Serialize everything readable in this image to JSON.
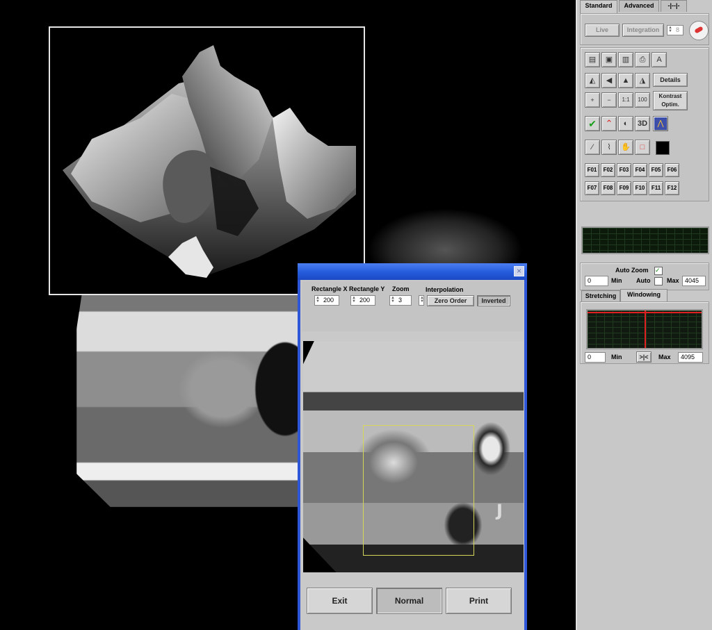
{
  "dialog": {
    "labels": {
      "rect_x": "Rectangle X",
      "rect_y": "Rectangle Y",
      "zoom": "Zoom",
      "interpolation": "Interpolation"
    },
    "values": {
      "rect_x": "200",
      "rect_y": "200",
      "zoom": "3"
    },
    "buttons": {
      "zero_order": "Zero Order",
      "inverted": "Inverted",
      "exit": "Exit",
      "normal": "Normal",
      "print": "Print"
    },
    "close_glyph": "×"
  },
  "panel": {
    "tabs": [
      "Standard",
      "Advanced",
      "-|--|-"
    ],
    "top_controls": {
      "live": "Live",
      "integration": "Integration",
      "integration_value": "8"
    },
    "tools": {
      "details": "Details",
      "kontrast": "Kontrast Optim.",
      "three_d": "3D",
      "zoom_100": "100"
    },
    "fkeys": [
      "F01",
      "F02",
      "F03",
      "F04",
      "F05",
      "F06",
      "F07",
      "F08",
      "F09",
      "F10",
      "F11",
      "F12"
    ],
    "auto_zoom": {
      "label": "Auto Zoom",
      "min_value": "0",
      "min_label": "Min",
      "auto_label": "Auto",
      "max_label": "Max",
      "max_value": "4045"
    },
    "subtabs": [
      "Stretching",
      "Windowing"
    ],
    "windowing": {
      "min_value": "0",
      "min_label": "Min",
      "center_button": ">|<",
      "max_label": "Max",
      "max_value": "4095"
    }
  },
  "colors": {
    "title_blue": "#245bdc",
    "panel_gray": "#c8c8c8",
    "scope_green": "#0b1a0b",
    "windowing_red": "#e02020"
  }
}
